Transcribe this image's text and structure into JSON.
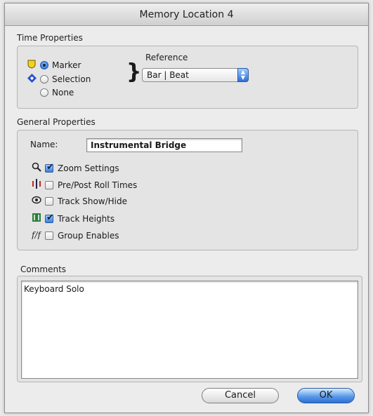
{
  "window": {
    "title": "Memory Location 4"
  },
  "time_properties": {
    "label": "Time Properties",
    "options": [
      {
        "label": "Marker",
        "selected": true,
        "icon": "marker-shield-icon"
      },
      {
        "label": "Selection",
        "selected": false,
        "icon": "selection-diamond-icon"
      },
      {
        "label": "None",
        "selected": false
      }
    ],
    "reference_label": "Reference",
    "reference_value": "Bar | Beat"
  },
  "general_properties": {
    "label": "General Properties",
    "name_label": "Name:",
    "name_value": "Instrumental Bridge",
    "options": [
      {
        "label": "Zoom Settings",
        "checked": true,
        "icon": "magnifier-icon"
      },
      {
        "label": "Pre/Post Roll Times",
        "checked": false,
        "icon": "pre-post-roll-icon"
      },
      {
        "label": "Track Show/Hide",
        "checked": false,
        "icon": "track-show-hide-icon"
      },
      {
        "label": "Track Heights",
        "checked": true,
        "icon": "track-heights-icon"
      },
      {
        "label": "Group Enables",
        "checked": false,
        "icon": "group-enables-icon"
      }
    ]
  },
  "comments": {
    "label": "Comments",
    "value": "Keyboard Solo"
  },
  "buttons": {
    "cancel": "Cancel",
    "ok": "OK"
  },
  "colors": {
    "accent": "#3b7de0",
    "marker_icon": "#f2d21b"
  }
}
